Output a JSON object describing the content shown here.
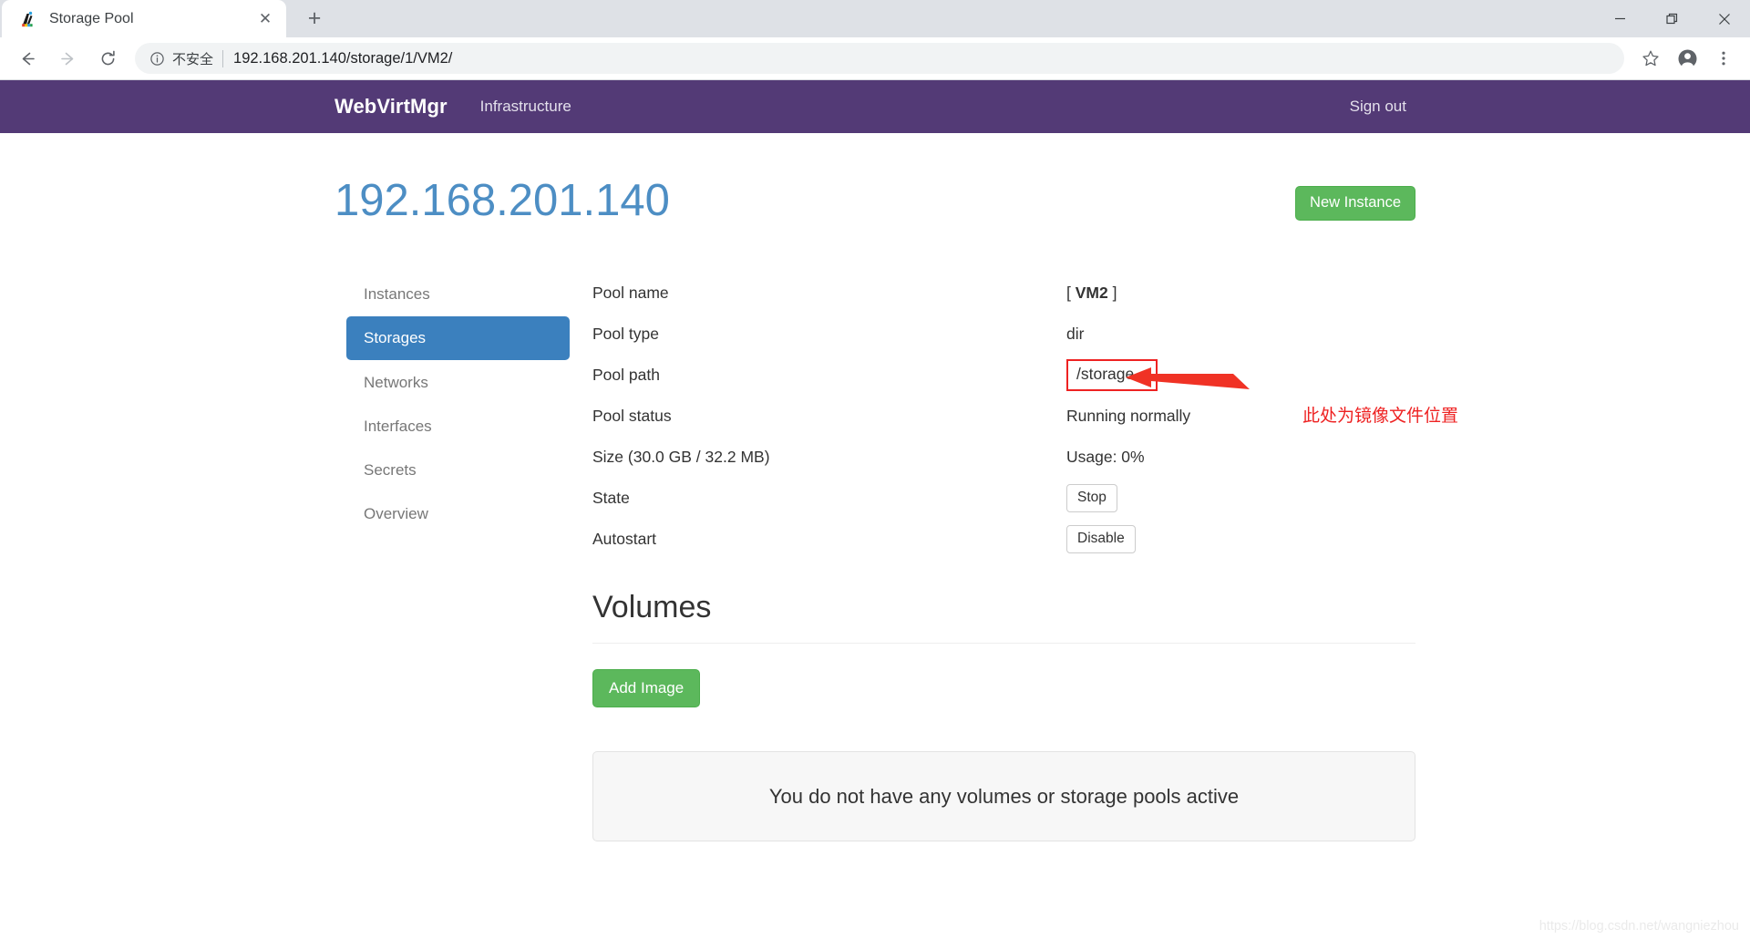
{
  "browser": {
    "tab": {
      "title": "Storage Pool",
      "favicon_name": "webvirtmgr-favicon",
      "close_label": "✕"
    },
    "new_tab_label": "+",
    "window_controls": {
      "minimize": "—",
      "maximize": "❐",
      "close": "✕"
    },
    "toolbar": {
      "back_label": "←",
      "forward_label": "→",
      "reload_label": "⟳",
      "security_text": "不安全",
      "url": "192.168.201.140/storage/1/VM2/",
      "bookmark_label": "☆",
      "profile_label": "profile",
      "menu_label": "⋮"
    }
  },
  "appnav": {
    "brand": "WebVirtMgr",
    "links": [
      {
        "label": "Infrastructure"
      }
    ],
    "signout": "Sign out",
    "bg_color": "#533a76"
  },
  "page": {
    "title": "192.168.201.140",
    "title_color": "#4d8ec4",
    "new_instance_label": "New Instance",
    "new_instance_color": "#5cb85c"
  },
  "sidebar": {
    "items": [
      {
        "label": "Instances",
        "active": false
      },
      {
        "label": "Storages",
        "active": true
      },
      {
        "label": "Networks",
        "active": false
      },
      {
        "label": "Interfaces",
        "active": false
      },
      {
        "label": "Secrets",
        "active": false
      },
      {
        "label": "Overview",
        "active": false
      }
    ],
    "active_color": "#3b80be"
  },
  "details": {
    "pool_name_label": "Pool name",
    "pool_name_prefix": "[ ",
    "pool_name_value": "VM2",
    "pool_name_suffix": " ]",
    "pool_type_label": "Pool type",
    "pool_type_value": "dir",
    "pool_path_label": "Pool path",
    "pool_path_value": "/storage",
    "pool_status_label": "Pool status",
    "pool_status_value": "Running normally",
    "size_label": "Size (30.0 GB / 32.2 MB)",
    "usage_value": "Usage: 0%",
    "state_label": "State",
    "state_button": "Stop",
    "autostart_label": "Autostart",
    "autostart_button": "Disable"
  },
  "annotation": {
    "text": "此处为镜像文件位置",
    "color": "#ee2222"
  },
  "volumes": {
    "title": "Volumes",
    "add_image_label": "Add Image",
    "empty_message": "You do not have any volumes or storage pools active"
  },
  "watermark": "https://blog.csdn.net/wangniezhou"
}
